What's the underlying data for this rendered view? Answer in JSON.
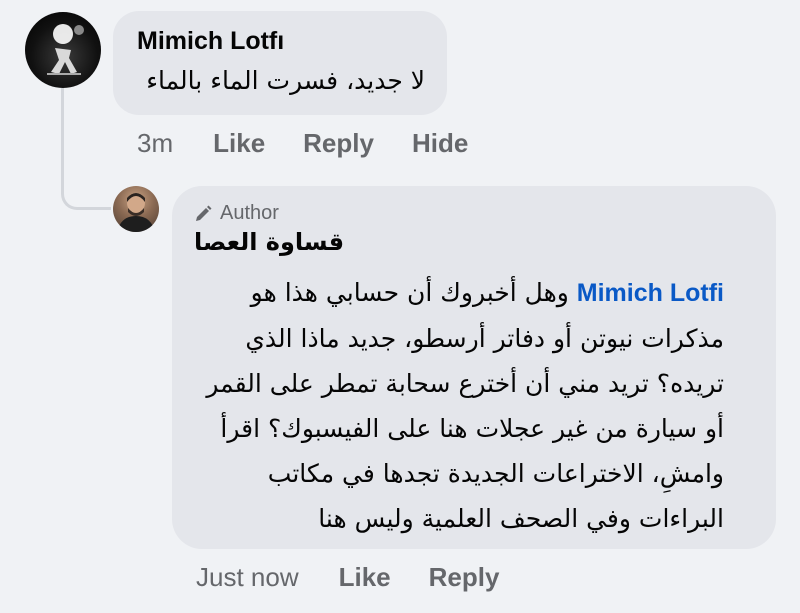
{
  "comment1": {
    "author": "Mimich Lotfı",
    "text": "لا جديد، فسرت الماء بالماء",
    "time": "3m",
    "actions": {
      "like": "Like",
      "reply": "Reply",
      "hide": "Hide"
    }
  },
  "reply1": {
    "badge": "Author",
    "author": "قساوة العصا",
    "mention": "Mimich Lotfi",
    "text_after_mention": "وهل أخبروك أن حسابي هذا هو مذكرات نيوتن أو دفاتر أرسطو، جديد ماذا الذي تريده؟ تريد مني أن أخترع سحابة تمطر على القمر أو سيارة من غير عجلات هنا على الفيسبوك؟ اقرأ وامشِ، الاختراعات الجديدة تجدها في مكاتب البراءات وفي الصحف العلمية وليس هنا",
    "time": "Just now",
    "actions": {
      "like": "Like",
      "reply": "Reply"
    }
  },
  "icons": {
    "badge_icon": "pencil-icon"
  }
}
